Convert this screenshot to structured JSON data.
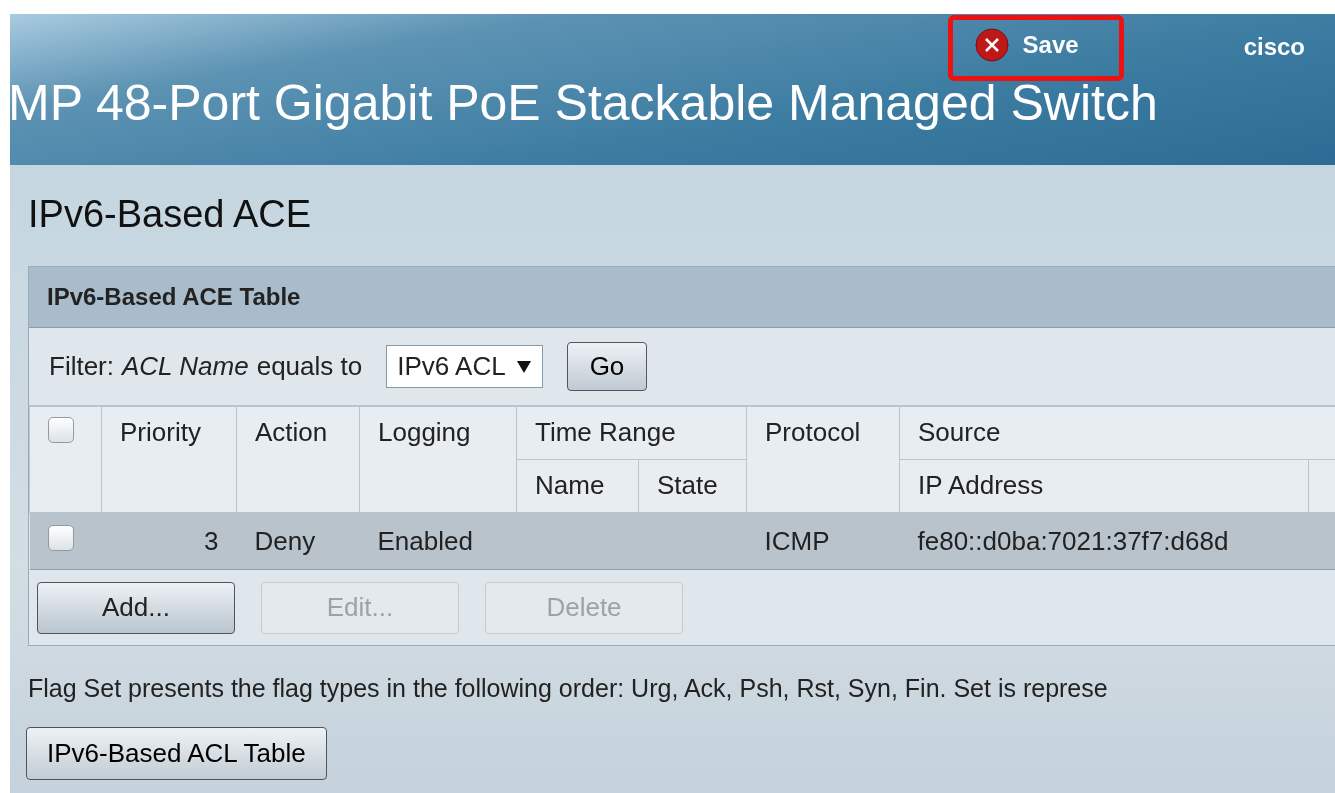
{
  "header": {
    "save_label": "Save",
    "brand": "cisco",
    "product_title": "MP 48-Port Gigabit PoE Stackable Managed Switch"
  },
  "page_title": "IPv6-Based ACE",
  "panel": {
    "title": "IPv6-Based ACE Table",
    "filter": {
      "label": "Filter:",
      "field": "ACL Name",
      "operator": "equals to",
      "value": "IPv6 ACL",
      "go": "Go"
    },
    "columns": {
      "select_all_checked": false,
      "priority": "Priority",
      "action": "Action",
      "logging": "Logging",
      "time_range": "Time Range",
      "time_range_name": "Name",
      "time_range_state": "State",
      "protocol": "Protocol",
      "source": "Source",
      "source_ip": "IP Address"
    },
    "rows": [
      {
        "checked": false,
        "priority": "3",
        "action": "Deny",
        "logging": "Enabled",
        "time_range_name": "",
        "time_range_state": "",
        "protocol": "ICMP",
        "source_ip": "fe80::d0ba:7021:37f7:d68d"
      }
    ],
    "buttons": [
      {
        "label": "Add...",
        "disabled": false
      },
      {
        "label": "Edit...",
        "disabled": true
      },
      {
        "label": "Delete",
        "disabled": true
      }
    ]
  },
  "note": "Flag Set presents the flag types in the following order: Urg, Ack, Psh, Rst, Syn, Fin. Set is represe",
  "acl_table_button": "IPv6-Based ACL Table"
}
